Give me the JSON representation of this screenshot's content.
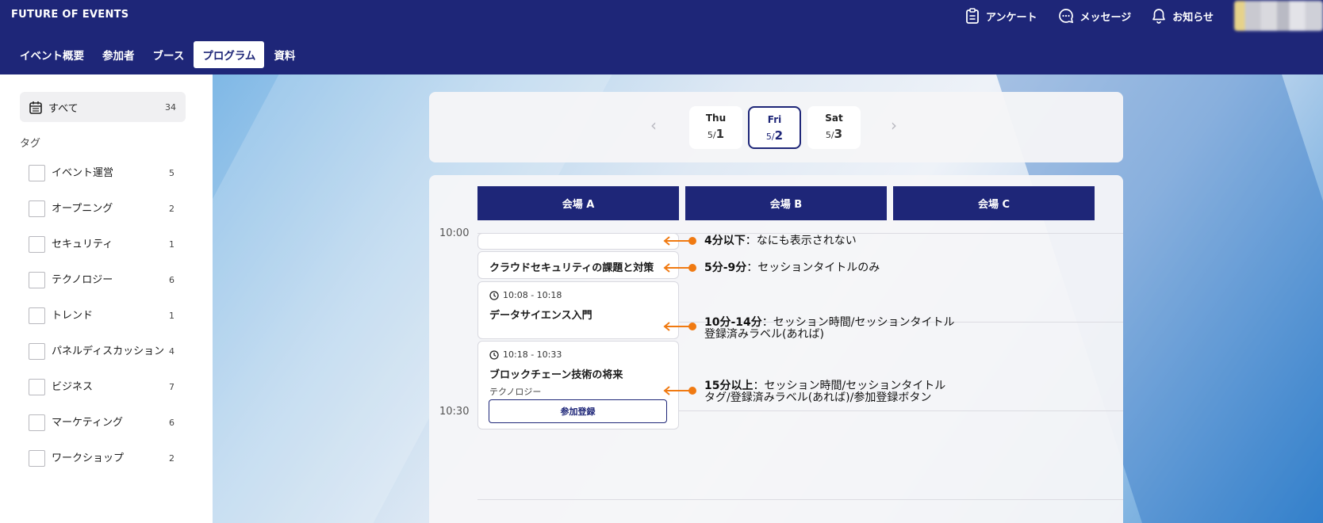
{
  "brand": "FUTURE OF EVENTS",
  "header": {
    "actions": [
      {
        "label": "アンケート",
        "icon": "clipboard-icon"
      },
      {
        "label": "メッセージ",
        "icon": "chat-icon"
      },
      {
        "label": "お知らせ",
        "icon": "bell-icon"
      }
    ]
  },
  "nav": {
    "tabs": [
      "イベント概要",
      "参加者",
      "ブース",
      "プログラム",
      "資料"
    ],
    "active": "プログラム"
  },
  "sidebar": {
    "all": {
      "label": "すべて",
      "count": "34"
    },
    "tag_heading": "タグ",
    "tags": [
      {
        "label": "イベント運営",
        "count": "5"
      },
      {
        "label": "オープニング",
        "count": "2"
      },
      {
        "label": "セキュリティ",
        "count": "1"
      },
      {
        "label": "テクノロジー",
        "count": "6"
      },
      {
        "label": "トレンド",
        "count": "1"
      },
      {
        "label": "パネルディスカッション",
        "count": "4"
      },
      {
        "label": "ビジネス",
        "count": "7"
      },
      {
        "label": "マーケティング",
        "count": "6"
      },
      {
        "label": "ワークショップ",
        "count": "2"
      }
    ]
  },
  "dates": {
    "days": [
      {
        "name": "Thu",
        "month": "5/",
        "day": "1"
      },
      {
        "name": "Fri",
        "month": "5/",
        "day": "2"
      },
      {
        "name": "Sat",
        "month": "5/",
        "day": "3"
      }
    ],
    "selected": "Fri"
  },
  "schedule": {
    "venues": [
      "会場 A",
      "会場 B",
      "会場 C"
    ],
    "times": [
      "10:00",
      "10:30"
    ],
    "sessions": [
      {
        "title": ""
      },
      {
        "title": "クラウドセキュリティの課題と対策"
      },
      {
        "time": "10:08 - 10:18",
        "title": "データサイエンス入門"
      },
      {
        "time": "10:18 - 10:33",
        "title": "ブロックチェーン技術の将来",
        "tag": "テクノロジー",
        "button": "参加登録"
      }
    ]
  },
  "annotations": [
    {
      "bold": "4分以下",
      "text": "：なにも表示されない",
      "line2": ""
    },
    {
      "bold": "5分-9分",
      "text": "：セッションタイトルのみ",
      "line2": ""
    },
    {
      "bold": "10分-14分",
      "text": "：セッション時間/セッションタイトル",
      "line2": "登録済みラベル(あれば)"
    },
    {
      "bold": "15分以上",
      "text": "：セッション時間/セッションタイトル",
      "line2": "タグ/登録済みラベル(あれば)/参加登録ボタン"
    }
  ],
  "colors": {
    "primary": "#1e2678",
    "annotation": "#f07a12"
  }
}
